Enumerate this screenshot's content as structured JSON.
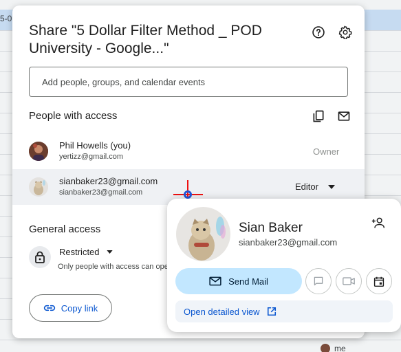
{
  "background": {
    "cell_text": "5-0",
    "me_label": "me"
  },
  "dialog": {
    "title": "Share \"5 Dollar Filter Method _ POD University - Google...\"",
    "help_icon": "help-circle-icon",
    "settings_icon": "gear-icon",
    "search_placeholder": "Add people, groups, and calendar events",
    "people_section_title": "People with access",
    "copy_emails_icon": "copy-icon",
    "email_icon": "mail-icon",
    "people": [
      {
        "name": "Phil Howells (you)",
        "email": "yertizz@gmail.com",
        "role": "Owner"
      },
      {
        "name": "sianbaker23@gmail.com",
        "email": "sianbaker23@gmail.com",
        "role": "Editor"
      }
    ],
    "general_access_title": "General access",
    "access_level": "Restricted",
    "access_description": "Only people with access can open with the link",
    "copy_link_label": "Copy link"
  },
  "hover_card": {
    "name": "Sian Baker",
    "email": "sianbaker23@gmail.com",
    "send_mail_label": "Send Mail",
    "open_detail_label": "Open detailed view",
    "accent_color": "#c2e7ff"
  }
}
